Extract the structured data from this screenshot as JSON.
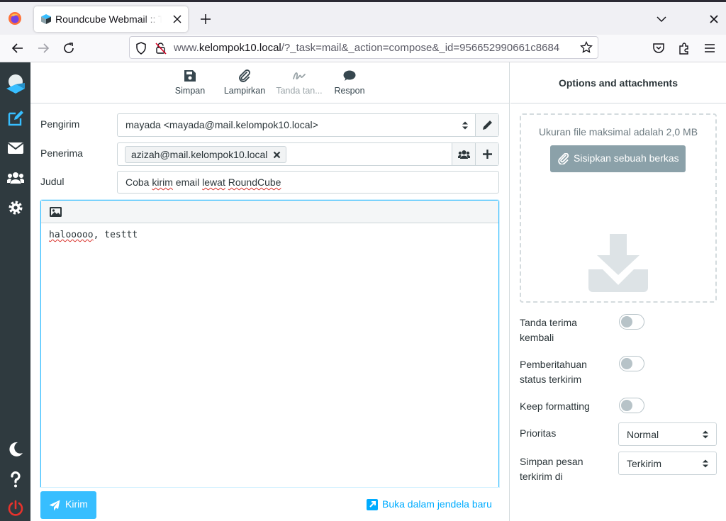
{
  "browser": {
    "tab_title": "Roundcube Webmail :: Tulis",
    "url_prefix": "www.",
    "url_domain": "kelompok10.local",
    "url_path": "/?_task=mail&_action=compose&_id=956652990661c8684"
  },
  "toolbar": {
    "save_label": "Simpan",
    "attach_label": "Lampirkan",
    "signature_label": "Tanda tan...",
    "respond_label": "Respon"
  },
  "compose": {
    "from_label": "Pengirim",
    "from_value": "mayada <mayada@mail.kelompok10.local>",
    "to_label": "Penerima",
    "to_recipient": "azizah@mail.kelompok10.local",
    "subject_label": "Judul",
    "subject_words": [
      "Coba",
      "kirim",
      "email",
      "lewat",
      "RoundCube"
    ],
    "body_first": "halooooo",
    "body_rest": ", testtt",
    "send_label": "Kirim",
    "new_window_label": "Buka dalam jendela baru"
  },
  "options": {
    "title": "Options and attachments",
    "max_size_hint": "Ukuran file maksimal adalah 2,0 MB",
    "attach_button": "Sisipkan sebuah berkas",
    "return_receipt_label": "Tanda terima kembali",
    "dsn_label": "Pemberitahuan status terkirim",
    "keep_formatting_label": "Keep formatting",
    "priority_label": "Prioritas",
    "priority_value": "Normal",
    "save_sent_label": "Simpan pesan terkirim di",
    "save_sent_value": "Terkirim",
    "toggles": {
      "return_receipt": false,
      "dsn": false,
      "keep_formatting": false
    }
  },
  "colors": {
    "accent": "#37beff",
    "sidebar": "#2f3a3f",
    "attach_button": "#8ba1a9"
  }
}
